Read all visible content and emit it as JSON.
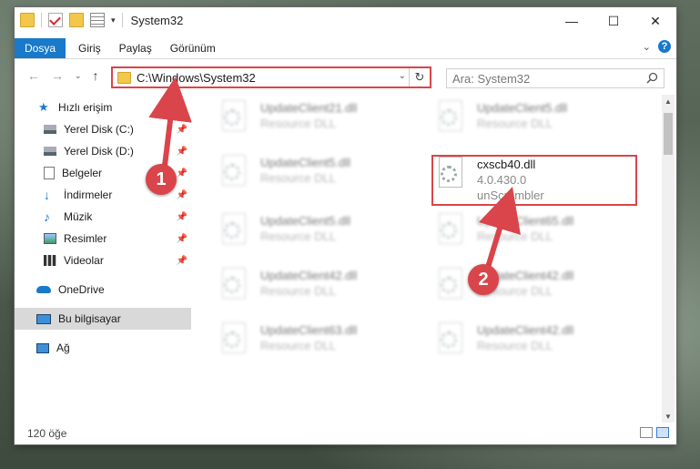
{
  "window": {
    "title": "System32",
    "minimize": "—",
    "maximize": "☐",
    "close": "✕"
  },
  "ribbon": {
    "file_tab": "Dosya",
    "tabs": [
      "Giriş",
      "Paylaş",
      "Görünüm"
    ],
    "help": "?"
  },
  "address": {
    "path": "C:\\Windows\\System32",
    "search_placeholder": "Ara: System32"
  },
  "sidebar": {
    "items": [
      {
        "label": "Hızlı erişim",
        "icon": "star-icon",
        "pinned": false
      },
      {
        "label": "Yerel Disk (C:)",
        "icon": "drive-icon",
        "pinned": true
      },
      {
        "label": "Yerel Disk (D:)",
        "icon": "drive-icon",
        "pinned": true
      },
      {
        "label": "Belgeler",
        "icon": "document-icon",
        "pinned": true
      },
      {
        "label": "İndirmeler",
        "icon": "download-icon",
        "pinned": true
      },
      {
        "label": "Müzik",
        "icon": "music-icon",
        "pinned": true
      },
      {
        "label": "Resimler",
        "icon": "pictures-icon",
        "pinned": true
      },
      {
        "label": "Videolar",
        "icon": "video-icon",
        "pinned": true
      },
      {
        "label": "OneDrive",
        "icon": "cloud-icon",
        "pinned": false
      },
      {
        "label": "Bu bilgisayar",
        "icon": "computer-icon",
        "pinned": false
      },
      {
        "label": "Ağ",
        "icon": "network-icon",
        "pinned": false
      }
    ]
  },
  "files": [
    {
      "name": "UpdateClient21.dll",
      "type": "Resource DLL"
    },
    {
      "name": "UpdateClient5.dll",
      "type": "Resource DLL"
    },
    {
      "name": "UpdateClient5.dll",
      "type": "Resource DLL"
    },
    {
      "name": "cxscb40.dll",
      "version": "4.0.430.0",
      "company": "unScrambler"
    },
    {
      "name": "UpdateClient5.dll",
      "type": "Resource DLL"
    },
    {
      "name": "UpdateClient65.dll",
      "type": "Resource DLL"
    },
    {
      "name": "UpdateClient42.dll",
      "type": "Resource DLL"
    },
    {
      "name": "UpdateClient42.dll",
      "type": "Resource DLL"
    },
    {
      "name": "UpdateClient63.dll",
      "type": "Resource DLL"
    },
    {
      "name": "UpdateClient42.dll",
      "type": "Resource DLL"
    }
  ],
  "status": {
    "count": "120 öğe"
  },
  "annotations": {
    "badge1": "1",
    "badge2": "2",
    "color": "#d9454a"
  }
}
